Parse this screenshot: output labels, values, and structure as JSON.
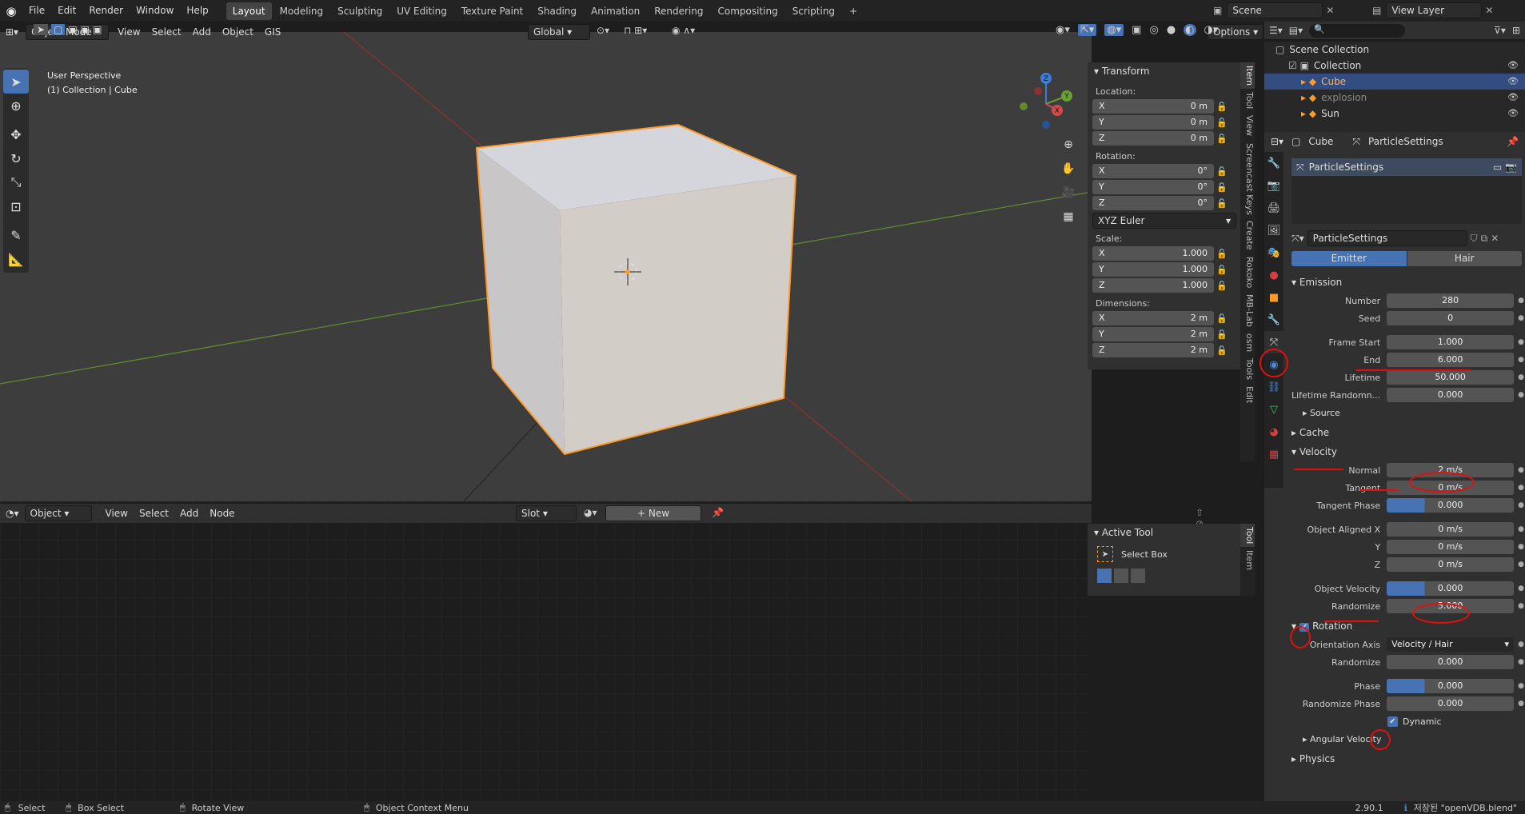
{
  "topbar": {
    "menus": [
      "File",
      "Edit",
      "Render",
      "Window",
      "Help"
    ],
    "workspaces": [
      "Layout",
      "Modeling",
      "Sculpting",
      "UV Editing",
      "Texture Paint",
      "Shading",
      "Animation",
      "Rendering",
      "Compositing",
      "Scripting"
    ],
    "active_workspace": "Layout",
    "add_tab": "+",
    "scene": "Scene",
    "view_layer": "View Layer"
  },
  "viewport": {
    "mode": "Object Mode",
    "menus": [
      "View",
      "Select",
      "Add",
      "Object",
      "GIS"
    ],
    "orientation": "Global",
    "options": "Options",
    "overlay_title": "User Perspective",
    "overlay_sub": "(1) Collection | Cube"
  },
  "npanel": {
    "title": "Transform",
    "location_label": "Location:",
    "location": [
      {
        "axis": "X",
        "value": "0 m"
      },
      {
        "axis": "Y",
        "value": "0 m"
      },
      {
        "axis": "Z",
        "value": "0 m"
      }
    ],
    "rotation_label": "Rotation:",
    "rotation": [
      {
        "axis": "X",
        "value": "0°"
      },
      {
        "axis": "Y",
        "value": "0°"
      },
      {
        "axis": "Z",
        "value": "0°"
      }
    ],
    "rotation_mode": "XYZ Euler",
    "scale_label": "Scale:",
    "scale": [
      {
        "axis": "X",
        "value": "1.000"
      },
      {
        "axis": "Y",
        "value": "1.000"
      },
      {
        "axis": "Z",
        "value": "1.000"
      }
    ],
    "dimensions_label": "Dimensions:",
    "dimensions": [
      {
        "axis": "X",
        "value": "2 m"
      },
      {
        "axis": "Y",
        "value": "2 m"
      },
      {
        "axis": "Z",
        "value": "2 m"
      }
    ],
    "tabs": [
      "Item",
      "Tool",
      "View",
      "Screencast Keys",
      "Create",
      "Rokoko",
      "MB-Lab",
      "osm",
      "Tools",
      "Edit"
    ]
  },
  "gizmo": {
    "z": "Z",
    "y": "Y",
    "x": "X"
  },
  "shader_editor": {
    "type": "Object",
    "menus": [
      "View",
      "Select",
      "Add",
      "Node"
    ],
    "slot": "Slot",
    "new_label": "New",
    "active_tool_title": "Active Tool",
    "active_tool_name": "Select Box",
    "tabs": [
      "Tool",
      "Item"
    ]
  },
  "outliner": {
    "rows": [
      {
        "name": "Scene Collection",
        "indent": 0
      },
      {
        "name": "Collection",
        "indent": 1
      },
      {
        "name": "Cube",
        "indent": 2,
        "selected": true
      },
      {
        "name": "explosion",
        "indent": 2,
        "dim": true
      },
      {
        "name": "Sun",
        "indent": 2
      }
    ]
  },
  "properties": {
    "breadcrumb_obj": "Cube",
    "breadcrumb_ps": "ParticleSettings",
    "slot_name": "ParticleSettings",
    "datablock": "ParticleSettings",
    "type_emitter": "Emitter",
    "type_hair": "Hair",
    "emission": {
      "title": "Emission",
      "rows": [
        {
          "label": "Number",
          "value": "280"
        },
        {
          "label": "Seed",
          "value": "0"
        },
        {
          "label": "Frame Start",
          "value": "1.000"
        },
        {
          "label": "End",
          "value": "6.000"
        },
        {
          "label": "Lifetime",
          "value": "50.000"
        },
        {
          "label": "Lifetime Randomn...",
          "value": "0.000"
        }
      ],
      "source": "Source"
    },
    "cache": "Cache",
    "velocity": {
      "title": "Velocity",
      "rows": [
        {
          "label": "Normal",
          "value": "2 m/s"
        },
        {
          "label": "Tangent",
          "value": "0 m/s"
        },
        {
          "label": "Tangent Phase",
          "value": "0.000"
        },
        {
          "label": "Object Aligned X",
          "value": "0 m/s"
        },
        {
          "label": "Y",
          "value": "0 m/s"
        },
        {
          "label": "Z",
          "value": "0 m/s"
        },
        {
          "label": "Object Velocity",
          "value": "0.000"
        },
        {
          "label": "Randomize",
          "value": "5.000"
        }
      ]
    },
    "rotation": {
      "title": "Rotation",
      "rows": [
        {
          "label": "Orientation Axis",
          "value": "Velocity / Hair"
        },
        {
          "label": "Randomize",
          "value": "0.000"
        },
        {
          "label": "Phase",
          "value": "0.000"
        },
        {
          "label": "Randomize Phase",
          "value": "0.000"
        }
      ],
      "dynamic": "Dynamic",
      "angular": "Angular Velocity"
    },
    "physics": "Physics"
  },
  "status": {
    "select": "Select",
    "box_select": "Box Select",
    "rotate_view": "Rotate View",
    "context_menu": "Object Context Menu",
    "version": "2.90.1",
    "message": "저장된 \"openVDB.blend\""
  }
}
